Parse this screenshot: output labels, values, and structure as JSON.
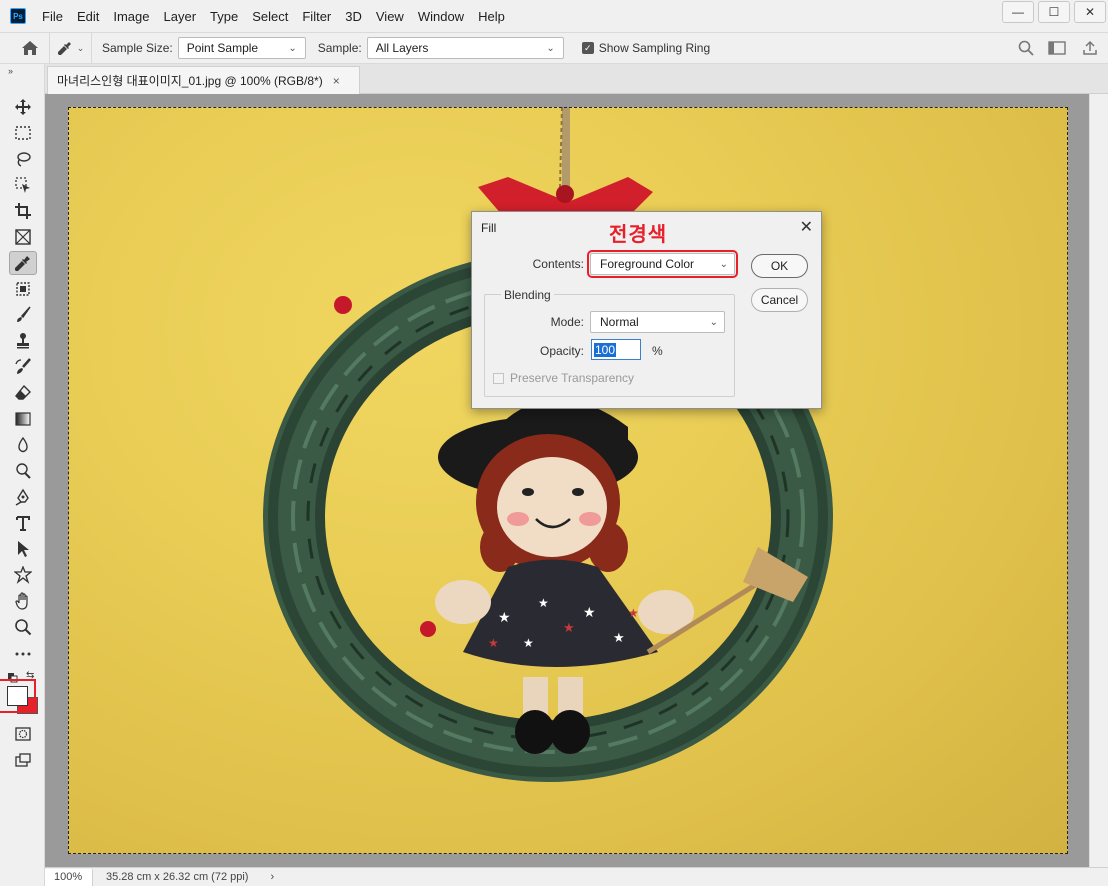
{
  "app": {
    "logo": "Ps"
  },
  "menu": [
    "File",
    "Edit",
    "Image",
    "Layer",
    "Type",
    "Select",
    "Filter",
    "3D",
    "View",
    "Window",
    "Help"
  ],
  "window_controls": {
    "minimize": "—",
    "restore": "☐",
    "close": "✕"
  },
  "options": {
    "sample_size_label": "Sample Size:",
    "sample_size_value": "Point Sample",
    "sample_label": "Sample:",
    "sample_value": "All Layers",
    "show_ring_label": "Show Sampling Ring",
    "show_ring_checked": true
  },
  "toolbar": {
    "collapse": "››"
  },
  "document": {
    "tab_title": "마녀리스인형 대표이미지_01.jpg @ 100% (RGB/8*)",
    "close": "×"
  },
  "status": {
    "zoom": "100%",
    "doc_size": "35.28 cm x 26.32 cm (72 ppi)",
    "arrow": "›"
  },
  "colors": {
    "foreground": "#ffffff",
    "background": "#e8202a",
    "annotation": "#e8202a"
  },
  "dialog": {
    "title": "Fill",
    "annotation": "전경색",
    "contents_label": "Contents:",
    "contents_value": "Foreground Color",
    "ok": "OK",
    "cancel": "Cancel",
    "blending_legend": "Blending",
    "mode_label": "Mode:",
    "mode_value": "Normal",
    "opacity_label": "Opacity:",
    "opacity_value": "100",
    "opacity_unit": "%",
    "preserve_label": "Preserve Transparency",
    "close": "✕"
  }
}
